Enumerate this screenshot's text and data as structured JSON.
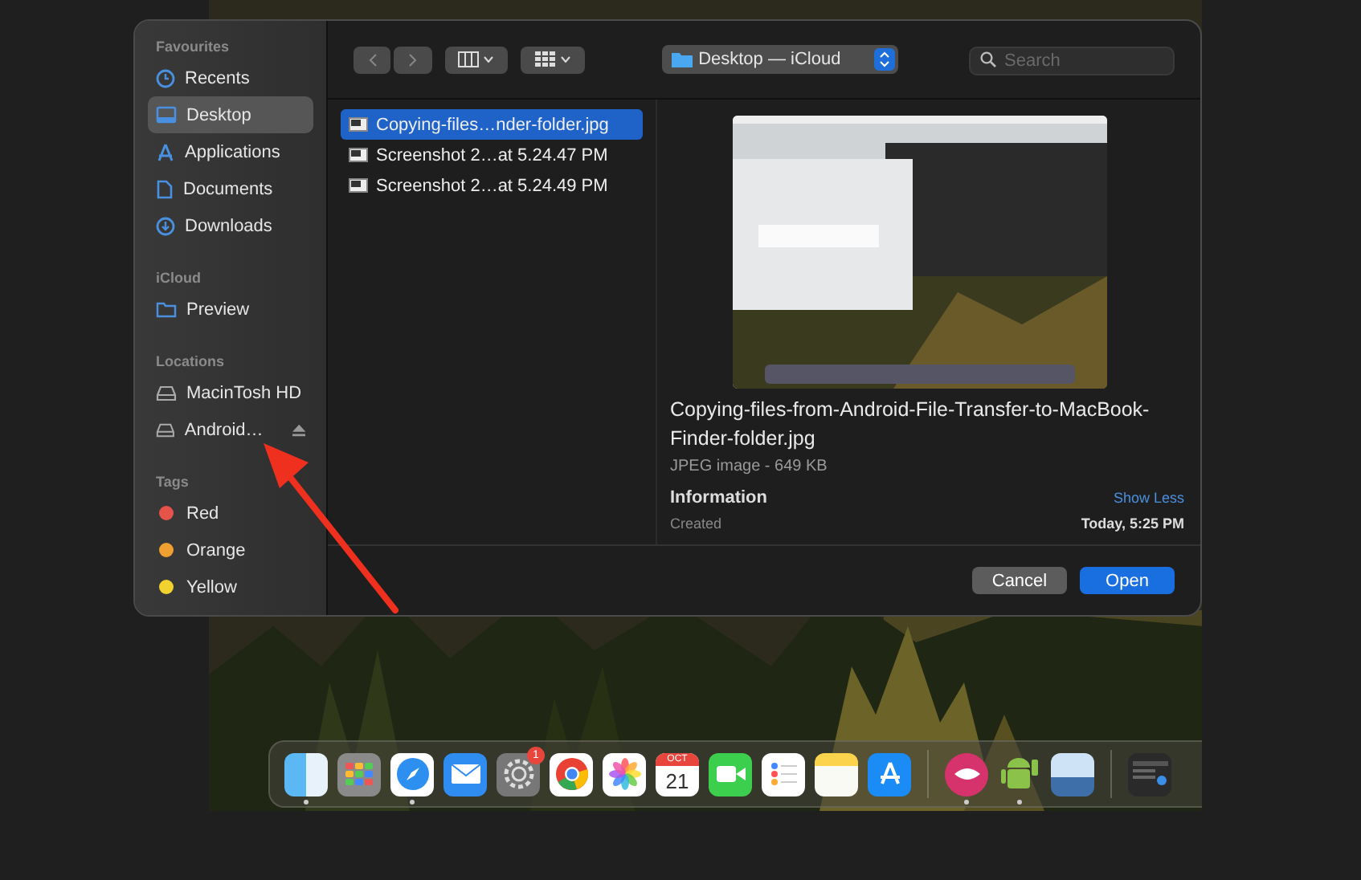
{
  "sidebar": {
    "sections": [
      {
        "heading": "Favourites",
        "items": [
          {
            "label": "Recents",
            "kind": "clock",
            "selected": false
          },
          {
            "label": "Desktop",
            "kind": "desktop",
            "selected": true
          },
          {
            "label": "Applications",
            "kind": "apps",
            "selected": false
          },
          {
            "label": "Documents",
            "kind": "doc",
            "selected": false
          },
          {
            "label": "Downloads",
            "kind": "download",
            "selected": false
          }
        ]
      },
      {
        "heading": "iCloud",
        "items": [
          {
            "label": "Preview",
            "kind": "folder",
            "selected": false
          }
        ]
      },
      {
        "heading": "Locations",
        "items": [
          {
            "label": "MacinTosh HD",
            "kind": "drive",
            "selected": false,
            "eject": false
          },
          {
            "label": "Android…",
            "kind": "drive",
            "selected": false,
            "eject": true
          }
        ]
      },
      {
        "heading": "Tags",
        "items": [
          {
            "label": "Red",
            "kind": "tag",
            "color": "#e5534b",
            "selected": false
          },
          {
            "label": "Orange",
            "kind": "tag",
            "color": "#f0a030",
            "selected": false
          },
          {
            "label": "Yellow",
            "kind": "tag",
            "color": "#f2d22e",
            "selected": false
          }
        ]
      }
    ]
  },
  "toolbar": {
    "location": "Desktop — iCloud",
    "search": {
      "placeholder": "Search"
    }
  },
  "files": [
    {
      "name": "Copying-files…nder-folder.jpg",
      "selected": true
    },
    {
      "name": "Screenshot 2…at 5.24.47 PM",
      "selected": false
    },
    {
      "name": "Screenshot 2…at 5.24.49 PM",
      "selected": false
    }
  ],
  "preview": {
    "kind": "picture",
    "title": "Copying-files-from-Android-File-Transfer-to-MacBook-Finder-folder.jpg",
    "subtitle": "JPEG image - 649 KB",
    "info_heading": "Information",
    "toggle": "Show Less",
    "rows": [
      {
        "label": "Created",
        "value": "Today, 5:25 PM"
      }
    ]
  },
  "buttons": [
    {
      "label": "Cancel",
      "kind": "secondary"
    },
    {
      "label": "Open",
      "kind": "primary"
    }
  ],
  "dock": {
    "items": [
      {
        "kind": "finder",
        "running": true
      },
      {
        "kind": "launchpad"
      },
      {
        "kind": "safari",
        "running": true
      },
      {
        "kind": "mail"
      },
      {
        "kind": "settings",
        "badge": "1"
      },
      {
        "kind": "chrome"
      },
      {
        "kind": "photos"
      },
      {
        "kind": "calendar",
        "month": "OCT",
        "day": "21"
      },
      {
        "kind": "facetime"
      },
      {
        "kind": "reminders"
      },
      {
        "kind": "notes"
      },
      {
        "kind": "appstore"
      },
      {
        "kind": "separator"
      },
      {
        "kind": "skitch",
        "running": true
      },
      {
        "kind": "android",
        "running": true
      },
      {
        "kind": "preview"
      },
      {
        "kind": "separator"
      },
      {
        "kind": "window"
      }
    ]
  }
}
